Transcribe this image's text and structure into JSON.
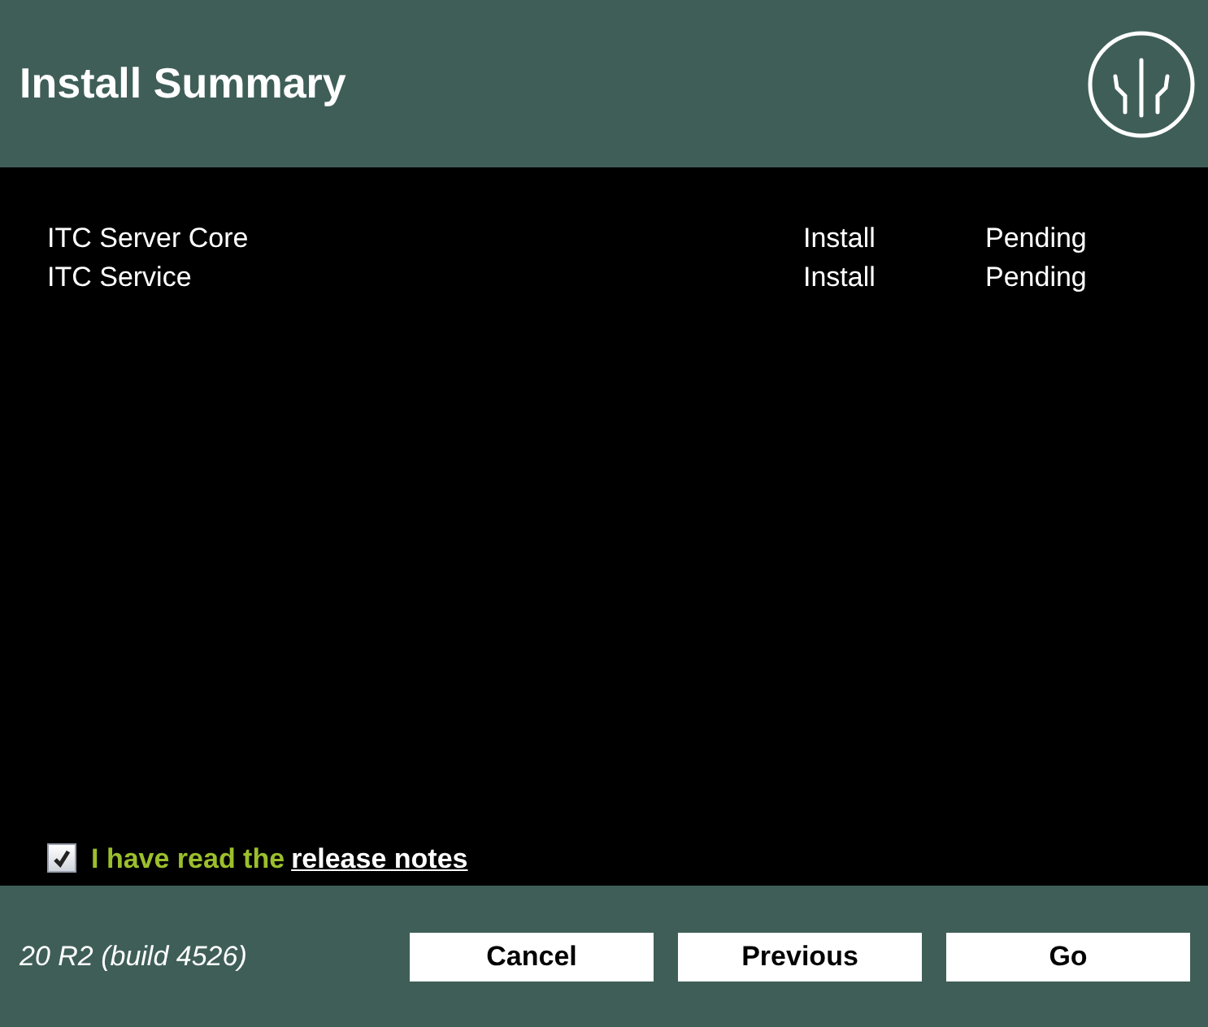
{
  "header": {
    "title": "Install Summary"
  },
  "items": [
    {
      "name": "ITC Server Core",
      "action": "Install",
      "status": "Pending"
    },
    {
      "name": "ITC Service",
      "action": "Install",
      "status": "Pending"
    }
  ],
  "agreement": {
    "label": "I have read the",
    "link": "release notes",
    "checked": true
  },
  "footer": {
    "version": "20 R2 (build 4526)",
    "buttons": [
      "Cancel",
      "Previous",
      "Go"
    ]
  }
}
